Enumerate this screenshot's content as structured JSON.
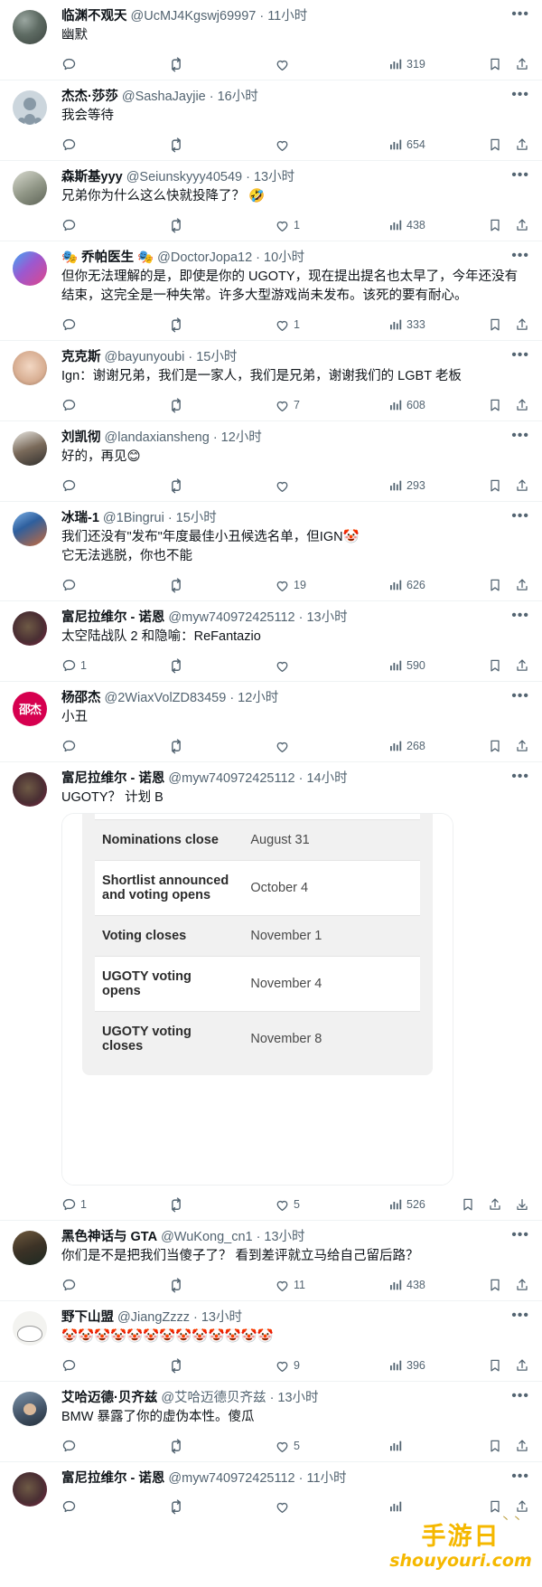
{
  "app": {
    "platform": "twitter-replies-feed",
    "locale": "zh-CN"
  },
  "icons": {
    "reply": "reply-icon",
    "retweet": "retweet-icon",
    "like": "heart-icon",
    "views": "views-bar-chart-icon",
    "bookmark": "bookmark-icon",
    "share": "share-upload-icon",
    "download": "download-icon",
    "more": "more-options-icon"
  },
  "separator": "·",
  "more_label": "•••",
  "watermark": {
    "line1": "手游日",
    "line2": "shouyouri.com",
    "marks": "丶丶"
  },
  "posts": [
    {
      "id": "post-1",
      "name": "临渊不观天",
      "handle": "@UcMJ4Kgswj69997",
      "time": "11小时",
      "text": "幽默",
      "avatar": "av-rock",
      "replies": "",
      "retweets": "",
      "likes": "",
      "views": "319",
      "has_download": false
    },
    {
      "id": "post-2",
      "name": "杰杰·莎莎",
      "handle": "@SashaJayjie",
      "time": "16小时",
      "text": "我会等待",
      "avatar": "av-def",
      "replies": "",
      "retweets": "",
      "likes": "",
      "views": "654",
      "has_download": false
    },
    {
      "id": "post-3",
      "name": "森斯基yyy",
      "handle": "@Seiunskyyy40549",
      "time": "13小时",
      "text": "兄弟你为什么这么快就投降了？ 🤣",
      "avatar": "av-anime",
      "replies": "",
      "retweets": "",
      "likes": "1",
      "views": "438",
      "has_download": false
    },
    {
      "id": "post-4",
      "name": "🎭 乔帕医生 🎭",
      "handle": "@DoctorJopa12",
      "time": "10小时",
      "text": "但你无法理解的是，即使是你的 UGOTY，现在提出提名也太早了，今年还没有结束，这完全是一种失常。许多大型游戏尚未发布。该死的要有耐心。",
      "avatar": "av-jopa",
      "replies": "",
      "retweets": "",
      "likes": "1",
      "views": "333",
      "has_download": false
    },
    {
      "id": "post-5",
      "name": "克克斯",
      "handle": "@bayunyoubi",
      "time": "15小时",
      "text": "Ign：谢谢兄弟，我们是一家人，我们是兄弟，谢谢我们的 LGBT 老板",
      "avatar": "av-face",
      "replies": "",
      "retweets": "",
      "likes": "7",
      "views": "608",
      "has_download": false
    },
    {
      "id": "post-6",
      "name": "刘凯彻",
      "handle": "@landaxiansheng",
      "time": "12小时",
      "text": "好的，再见😊",
      "avatar": "av-liu",
      "replies": "",
      "retweets": "",
      "likes": "",
      "views": "293",
      "has_download": false
    },
    {
      "id": "post-7",
      "name": "冰瑞-1",
      "handle": "@1Bingrui",
      "time": "15小时",
      "text": "我们还没有\"发布\"年度最佳小丑候选名单，但IGN🤡\n它无法逃脱，你也不能",
      "avatar": "av-bing",
      "replies": "",
      "retweets": "",
      "likes": "19",
      "views": "626",
      "has_download": false
    },
    {
      "id": "post-8",
      "name": "富尼拉维尔 - 诺恩",
      "handle": "@myw740972425112",
      "time": "13小时",
      "text": "太空陆战队 2 和隐喻：ReFantazio",
      "avatar": "av-funi",
      "replies": "1",
      "retweets": "",
      "likes": "",
      "views": "590",
      "has_download": false
    },
    {
      "id": "post-9",
      "name": "杨邵杰",
      "handle": "@2WiaxVolZD83459",
      "time": "12小时",
      "text": "小丑",
      "avatar": "av-yang",
      "avatar_text": "邵杰",
      "replies": "",
      "retweets": "",
      "likes": "",
      "views": "268",
      "has_download": false
    },
    {
      "id": "post-10",
      "name": "富尼拉维尔 - 诺恩",
      "handle": "@myw740972425112",
      "time": "14小时",
      "text": "UGOTY？ 计划 B",
      "avatar": "av-funi",
      "replies": "1",
      "retweets": "",
      "likes": "5",
      "views": "526",
      "has_download": true,
      "media": {
        "type": "schedule-table-image",
        "clipped_top_label": "open",
        "rows": [
          {
            "label": "Nominations close",
            "value": "August 31"
          },
          {
            "label": "Shortlist announced and voting opens",
            "value": "October 4"
          },
          {
            "label": "Voting closes",
            "value": "November 1"
          },
          {
            "label": "UGOTY voting opens",
            "value": "November 4"
          },
          {
            "label": "UGOTY voting closes",
            "value": "November 8"
          }
        ]
      }
    },
    {
      "id": "post-11",
      "name": "黑色神话与 GTA",
      "handle": "@WuKong_cn1",
      "time": "13小时",
      "text": "你们是不是把我们当傻子了？ 看到差评就立马给自己留后路？",
      "avatar": "av-wukong",
      "replies": "",
      "retweets": "",
      "likes": "11",
      "views": "438",
      "has_download": false
    },
    {
      "id": "post-12",
      "name": "野下山盟",
      "handle": "@JiangZzzz",
      "time": "13小时",
      "text": "🤡🤡🤡🤡🤡🤡🤡🤡🤡🤡🤡🤡🤡",
      "avatar": "av-jiang",
      "replies": "",
      "retweets": "",
      "likes": "9",
      "views": "396",
      "has_download": false
    },
    {
      "id": "post-13",
      "name": "艾哈迈德·贝齐兹",
      "handle": "@艾哈迈德贝齐兹",
      "time": "13小时",
      "text": "BMW 暴露了你的虚伪本性。傻瓜",
      "avatar": "av-bmw",
      "replies": "",
      "retweets": "",
      "likes": "5",
      "views": "",
      "has_download": false
    },
    {
      "id": "post-14",
      "name": "富尼拉维尔 - 诺恩",
      "handle": "@myw740972425112",
      "time": "11小时",
      "text": "",
      "avatar": "av-funi",
      "replies": "",
      "retweets": "",
      "likes": "",
      "views": "",
      "has_download": false
    }
  ]
}
